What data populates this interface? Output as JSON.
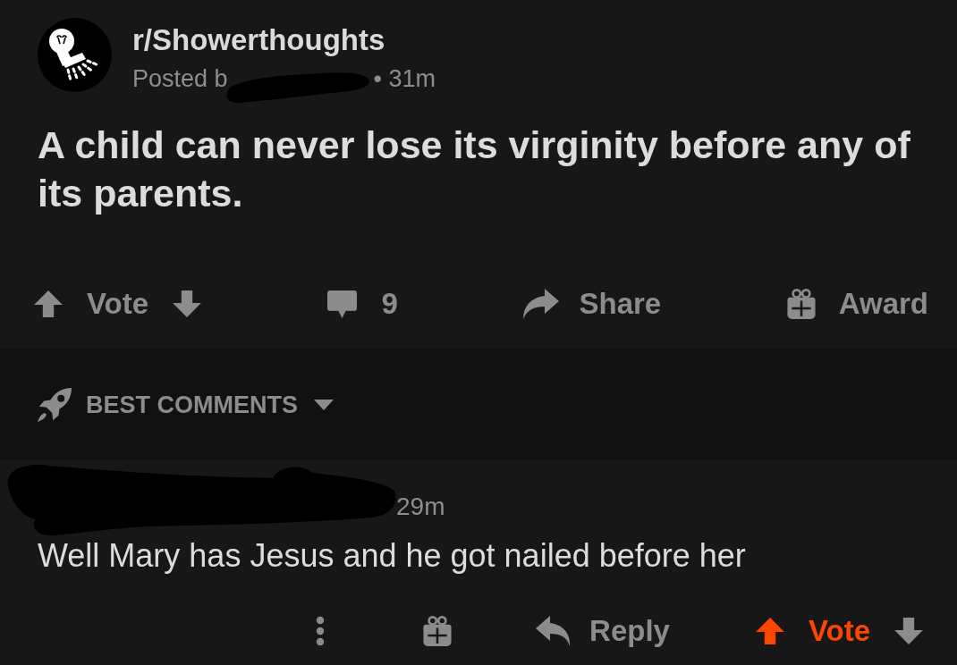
{
  "post": {
    "subreddit": "r/Showerthoughts",
    "posted_prefix": "Posted b",
    "author_redacted": true,
    "age": "• 31m",
    "title": "A child can never lose its virginity before any of its parents.",
    "actions": {
      "vote_label": "Vote",
      "upvoted": false,
      "downvoted": false,
      "comments": "9",
      "share": "Share",
      "award": "Award"
    }
  },
  "sort": {
    "label": "BEST COMMENTS"
  },
  "comments": [
    {
      "author_redacted": true,
      "age": "29m",
      "body": "Well Mary has Jesus and he got nailed before her",
      "reply": "Reply",
      "vote_label": "Vote",
      "upvoted": true,
      "downvoted": false
    }
  ]
}
